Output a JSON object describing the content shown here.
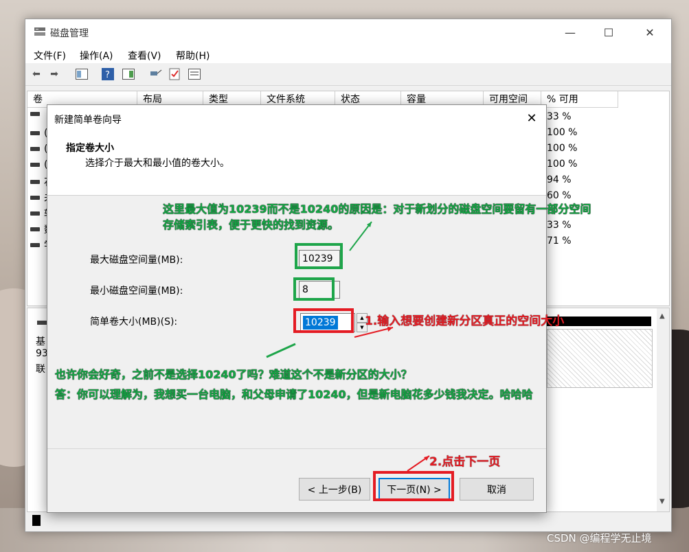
{
  "window": {
    "title": "磁盘管理",
    "menu": [
      "文件(F)",
      "操作(A)",
      "查看(V)",
      "帮助(H)"
    ]
  },
  "volume_list": {
    "columns": [
      "卷",
      "布局",
      "类型",
      "文件系统",
      "状态",
      "容量",
      "可用空间",
      "% 可用"
    ],
    "row_glyphs": [
      "",
      "(",
      "(",
      "(",
      "石",
      "未",
      "软",
      "数",
      "学"
    ],
    "percent_free": [
      "33 %",
      "100 %",
      "100 %",
      "100 %",
      "94 %",
      "60 %",
      "",
      "33 %",
      "71 %"
    ]
  },
  "disk_pane": {
    "labels": [
      "基",
      "93",
      "联"
    ]
  },
  "wizard": {
    "title": "新建简单卷向导",
    "heading": "指定卷大小",
    "subheading": "选择介于最大和最小值的卷大小。",
    "max_label": "最大磁盘空间量(MB):",
    "max_value": "10239",
    "min_label": "最小磁盘空间量(MB):",
    "min_value": "8",
    "size_label": "简单卷大小(MB)(S):",
    "size_value": "10239",
    "back_label": "< 上一步(B)",
    "next_label": "下一页(N) >",
    "cancel_label": "取消"
  },
  "annotations": {
    "note_top_line1": "这里最大值为10239而不是10240的原因是：对于新划分的磁盘空间要留有一部分空间",
    "note_top_line2": "存储索引表，便于更快的找到资源。",
    "note_step1": "1.输入想要创建新分区真正的空间大小",
    "note_mid_line1": "也许你会好奇，之前不是选择10240了吗？难道这个不是新分区的大小？",
    "note_mid_line2": "答：你可以理解为，我想买一台电脑，和父母申请了10240，但是新电脑花多少钱我决定。哈哈哈",
    "note_step2": "2.点击下一页"
  },
  "watermark": "CSDN @编程学无止境",
  "colors": {
    "annotation_green": "#1ea54a",
    "annotation_red": "#e41b23",
    "selection_blue": "#0078d7"
  }
}
